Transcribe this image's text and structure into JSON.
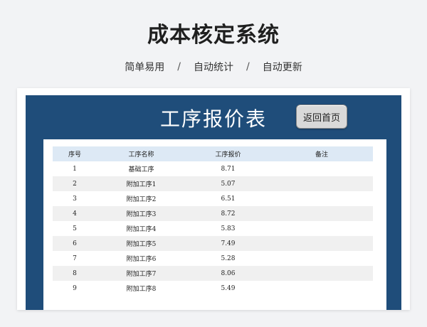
{
  "hero": {
    "title": "成本核定系统",
    "tags": [
      "简单易用",
      "自动统计",
      "自动更新"
    ],
    "separator": "/"
  },
  "sheet": {
    "title": "工序报价表",
    "home_button": "返回首页",
    "columns": [
      "序号",
      "工序名称",
      "工序报价",
      "备注"
    ],
    "rows": [
      {
        "no": "1",
        "name": "基础工序",
        "price": "8.71",
        "note": ""
      },
      {
        "no": "2",
        "name": "附加工序1",
        "price": "5.07",
        "note": ""
      },
      {
        "no": "3",
        "name": "附加工序2",
        "price": "6.51",
        "note": ""
      },
      {
        "no": "4",
        "name": "附加工序3",
        "price": "8.72",
        "note": ""
      },
      {
        "no": "5",
        "name": "附加工序4",
        "price": "5.83",
        "note": ""
      },
      {
        "no": "6",
        "name": "附加工序5",
        "price": "7.49",
        "note": ""
      },
      {
        "no": "7",
        "name": "附加工序6",
        "price": "5.28",
        "note": ""
      },
      {
        "no": "8",
        "name": "附加工序7",
        "price": "8.06",
        "note": ""
      },
      {
        "no": "9",
        "name": "附加工序8",
        "price": "5.49",
        "note": ""
      }
    ]
  },
  "colors": {
    "sheet_background": "#1f4d7a",
    "header_row": "#dde9f5",
    "stripe_row": "#f0f0f0"
  }
}
